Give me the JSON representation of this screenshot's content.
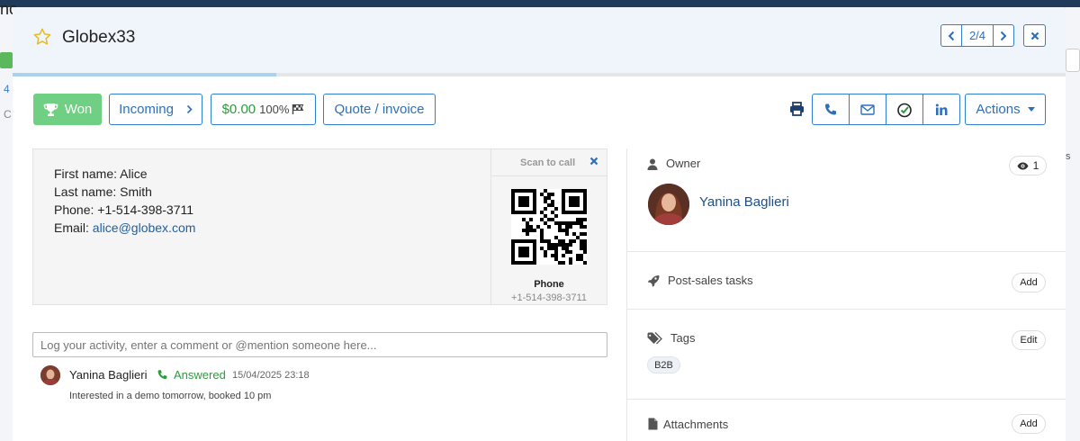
{
  "background": {
    "left_text": "nc",
    "left_count": "4",
    "left_letter": "C",
    "right_text": "s"
  },
  "header": {
    "title": "Globex33",
    "pager": {
      "count": "2/4"
    }
  },
  "progress": {
    "fraction": 0.25
  },
  "toolbar": {
    "won_label": "Won",
    "stage_label": "Incoming",
    "amount": "$0.00",
    "probability": "100%",
    "quote_label": "Quote / invoice",
    "actions_label": "Actions"
  },
  "contact": {
    "first_name": "First name: Alice",
    "last_name": "Last name: Smith",
    "phone": "Phone: +1-514-398-3711",
    "email_prefix": "Email: ",
    "email": "alice@globex.com",
    "qr": {
      "title": "Scan to call",
      "label": "Phone",
      "phone": "+1-514-398-3711"
    }
  },
  "activity": {
    "placeholder": "Log your activity, enter a comment or @mention someone here...",
    "entries": [
      {
        "user": "Yanina Baglieri",
        "status": "Answered",
        "time": "15/04/2025 23:18",
        "message": "Interested in a demo tomorrow, booked 10 pm"
      }
    ]
  },
  "sidebar": {
    "owner_label": "Owner",
    "watchers": "1",
    "owner_name": "Yanina Baglieri",
    "tasks_label": "Post-sales tasks",
    "tasks_button": "Add",
    "tags_label": "Tags",
    "tags_button": "Edit",
    "tags": [
      "B2B"
    ],
    "attachments_label": "Attachments",
    "attachments_button": "Add"
  },
  "colors": {
    "accent": "#2f80d1",
    "won": "#6fcf82",
    "green_text": "#2e9a3e",
    "header_bg": "#f0f5fb",
    "star": "#e8b923"
  }
}
